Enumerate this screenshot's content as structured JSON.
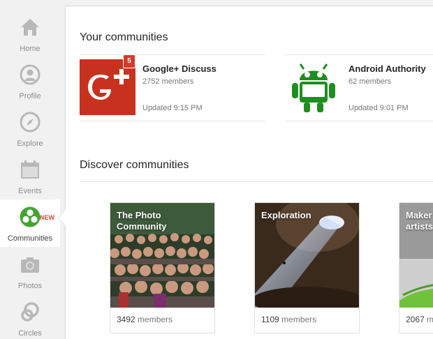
{
  "sidebar": {
    "items": [
      {
        "label": "Home",
        "icon": "home-icon"
      },
      {
        "label": "Profile",
        "icon": "profile-icon"
      },
      {
        "label": "Explore",
        "icon": "compass-icon"
      },
      {
        "label": "Events",
        "icon": "calendar-icon"
      },
      {
        "label": "Communities",
        "icon": "communities-icon",
        "active": true,
        "badge": "NEW"
      },
      {
        "label": "Photos",
        "icon": "camera-icon"
      },
      {
        "label": "Circles",
        "icon": "circles-icon"
      }
    ]
  },
  "your_communities": {
    "title": "Your communities",
    "items": [
      {
        "name": "Google+ Discuss",
        "members": "2752 members",
        "updated": "Updated 9:15 PM",
        "notification_count": "5"
      },
      {
        "name": "Android Authority",
        "members": "62 members",
        "updated": "Updated 9:01 PM"
      }
    ]
  },
  "discover": {
    "title": "Discover communities",
    "items": [
      {
        "title": "The Photo Community",
        "count": "3492",
        "unit": "members"
      },
      {
        "title": "Exploration",
        "count": "1109",
        "unit": "members"
      },
      {
        "title": "Maker artists",
        "count": "2067",
        "unit": "members"
      }
    ]
  },
  "colors": {
    "accent_red": "#d33b2b",
    "active_green": "#45a332",
    "android_green": "#1e8f1e"
  }
}
